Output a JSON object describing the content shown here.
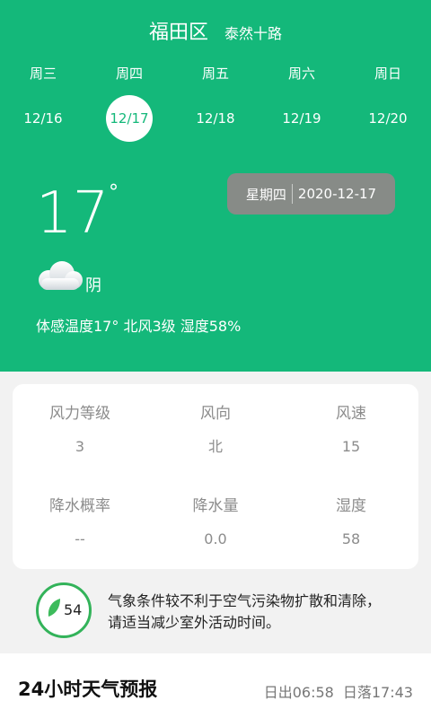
{
  "header": {
    "district": "福田区",
    "street": "泰然十路"
  },
  "days": [
    {
      "weekday": "周三",
      "date": "12/16",
      "active": false
    },
    {
      "weekday": "周四",
      "date": "12/17",
      "active": true
    },
    {
      "weekday": "周五",
      "date": "12/18",
      "active": false
    },
    {
      "weekday": "周六",
      "date": "12/19",
      "active": false
    },
    {
      "weekday": "周日",
      "date": "12/20",
      "active": false
    }
  ],
  "current": {
    "temperature": "17",
    "degree_symbol": "°",
    "weekday": "星期四",
    "date": "2020-12-17",
    "condition": "阴",
    "condition_icon": "cloud-icon",
    "feels_like": "体感温度17°",
    "wind": "北风3级",
    "humidity": "湿度58%"
  },
  "details": [
    {
      "label": "风力等级",
      "value": "3"
    },
    {
      "label": "风向",
      "value": "北"
    },
    {
      "label": "风速",
      "value": "15"
    },
    {
      "label": "降水概率",
      "value": "--"
    },
    {
      "label": "降水量",
      "value": "0.0"
    },
    {
      "label": "湿度",
      "value": "58"
    }
  ],
  "air": {
    "aqi": "54",
    "icon": "leaf-icon",
    "line1": "气象条件较不利于空气污染物扩散和清除，",
    "line2": "请适当减少室外活动时间。"
  },
  "forecast": {
    "title": "24小时天气预报",
    "sunrise": "日出06:58",
    "sunset": "日落17:43"
  },
  "colors": {
    "accent": "#14b87a",
    "date_chip": "#878b87",
    "aqi_ring": "#33b35a"
  }
}
